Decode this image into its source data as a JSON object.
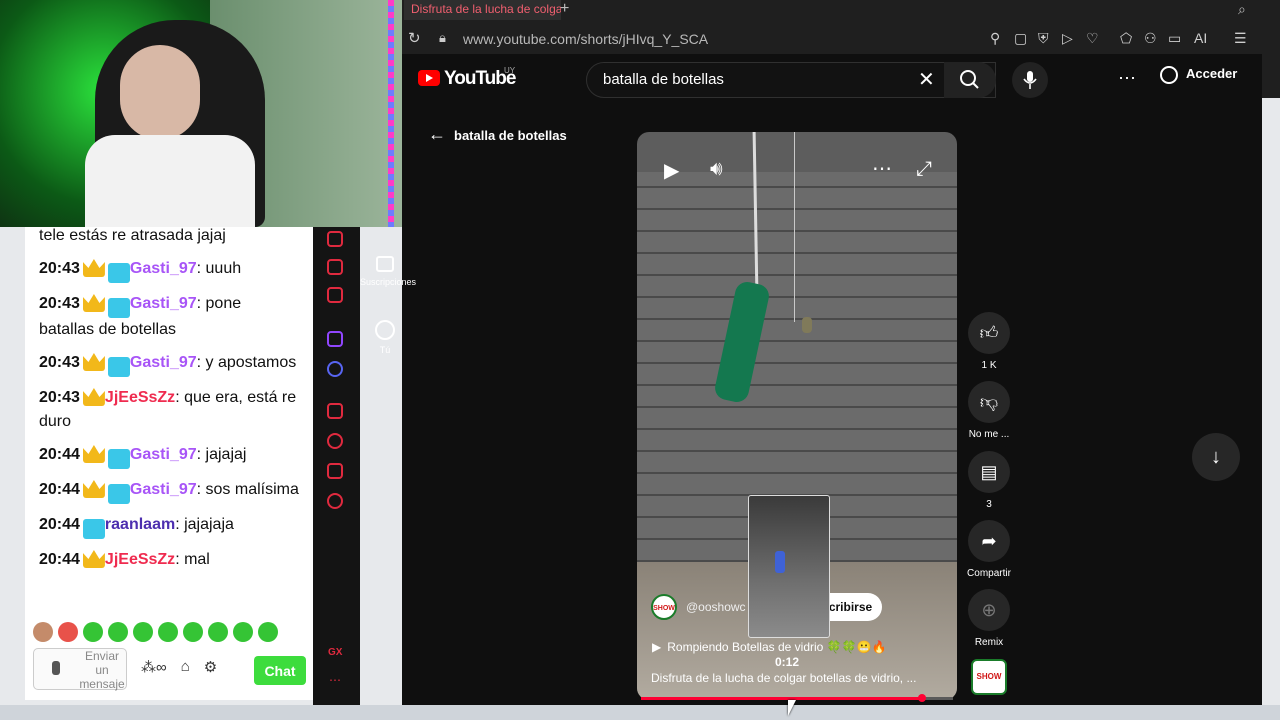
{
  "browser": {
    "tab_title": "Disfruta de la lucha de colgar botellas de vidrio",
    "tab_plus": "+",
    "url": "www.youtube.com/shorts/jHIvq_Y_SCA",
    "ai_label": "AI"
  },
  "youtube": {
    "logo_text": "YouTube",
    "country": "UY",
    "search_value": "batalla de botellas",
    "signin": "Acceder",
    "back_query": "batalla de botellas",
    "sidebar": [
      {
        "label": "Suscripciones",
        "icon": "subscriptions-icon"
      },
      {
        "label": "Tú",
        "icon": "you-icon"
      }
    ],
    "short": {
      "channel": "@ooshowc",
      "subscribe": "cribirse",
      "track": "Rompiendo Botellas de vidrio 🍀🍀😬🔥",
      "timecode": "0:12",
      "description": "Disfruta de la lucha de colgar botellas de vidrio, ...",
      "progress": 0.9,
      "channel_logo_text": "SHOW"
    },
    "actions": {
      "like_count": "1 K",
      "dislike_label": "No me ...",
      "comments_count": "3",
      "share_label": "Compartir",
      "remix_label": "Remix"
    }
  },
  "chat": {
    "messages": [
      {
        "time": "",
        "user": "",
        "text": "tele estás re atrasada jajaj",
        "badges": []
      },
      {
        "time": "20:43",
        "user": "Gasti_97",
        "text": ": uuuh",
        "badges": [
          "crown",
          "gg"
        ],
        "color": "purple"
      },
      {
        "time": "20:43",
        "user": "Gasti_97",
        "text": ": pone batallas de botellas",
        "badges": [
          "crown",
          "gg"
        ],
        "color": "purple"
      },
      {
        "time": "20:43",
        "user": "Gasti_97",
        "text": ": y apostamos",
        "badges": [
          "crown",
          "gg"
        ],
        "color": "purple"
      },
      {
        "time": "20:43",
        "user": "JjEeSsZz",
        "text": ": que era, está re duro",
        "badges": [
          "crown"
        ],
        "color": "red"
      },
      {
        "time": "20:44",
        "user": "Gasti_97",
        "text": ": jajajaj",
        "badges": [
          "crown",
          "gg"
        ],
        "color": "purple"
      },
      {
        "time": "20:44",
        "user": "Gasti_97",
        "text": ": sos malísima",
        "badges": [
          "crown",
          "gg"
        ],
        "color": "purple"
      },
      {
        "time": "20:44",
        "user": "raanlaam",
        "text": ": jajajaja",
        "badges": [
          "gg"
        ],
        "color": "indigo"
      },
      {
        "time": "20:44",
        "user": "JjEeSsZz",
        "text": ": mal",
        "badges": [
          "crown"
        ],
        "color": "red"
      }
    ],
    "input_placeholder": "Enviar un mensaje",
    "chat_button": "Chat",
    "gx_label": "GX"
  },
  "colors": {
    "youtube_red": "#ff0000",
    "chat_green": "#3ddc3d",
    "opera_red": "#e02a3f"
  }
}
